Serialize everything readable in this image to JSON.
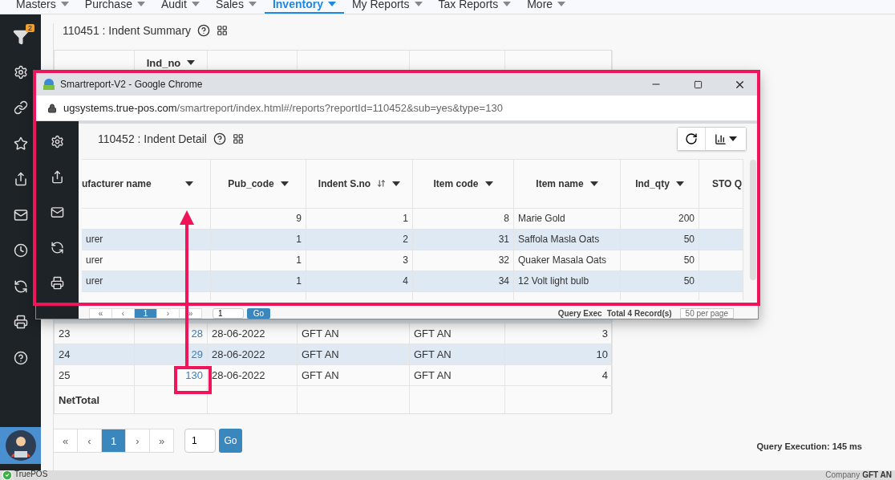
{
  "nav": [
    {
      "label": "Masters",
      "selected": false
    },
    {
      "label": "Purchase",
      "selected": false
    },
    {
      "label": "Audit",
      "selected": false
    },
    {
      "label": "Sales",
      "selected": false
    },
    {
      "label": "Inventory",
      "selected": true
    },
    {
      "label": "My Reports",
      "selected": false
    },
    {
      "label": "Tax Reports",
      "selected": false
    },
    {
      "label": "More",
      "selected": false
    }
  ],
  "sidebar": {
    "filter_badge": "2"
  },
  "report": {
    "title": "110451 : Indent Summary",
    "columns": [
      null,
      {
        "label": "Ind_no"
      },
      null,
      null,
      null,
      null
    ],
    "rows": [
      [
        "23",
        "28",
        "28-06-2022",
        "GFT AN",
        "GFT AN",
        "3"
      ],
      [
        "24",
        "29",
        "28-06-2022",
        "GFT AN",
        "GFT AN",
        "10"
      ],
      [
        "25",
        "130",
        "28-06-2022",
        "GFT AN",
        "GFT AN",
        "4"
      ]
    ],
    "total_label": "NetTotal",
    "pagination": {
      "pages": [
        {
          "label": "«",
          "selected": false
        },
        {
          "label": "‹",
          "selected": false
        },
        {
          "label": "1",
          "selected": true
        },
        {
          "label": "›",
          "selected": false
        },
        {
          "label": "»",
          "selected": false
        }
      ],
      "page_input": "1",
      "go": "Go"
    },
    "query_execution": "Query Execution: 145 ms"
  },
  "popup": {
    "window_title": "Smartreport-V2 - Google Chrome",
    "url_host": "ugsystems.true-pos.com",
    "url_path": "/smartreport/index.html#/reports?reportId=110452&sub=yes&type=130",
    "title": "110452 : Indent Detail",
    "columns": [
      {
        "label": "ufacturer name",
        "sort": false
      },
      {
        "label": "Pub_code",
        "sort": false
      },
      {
        "label": "Indent S.no",
        "sort": true
      },
      {
        "label": "Item code",
        "sort": false
      },
      {
        "label": "Item name",
        "sort": false
      },
      {
        "label": "Ind_qty",
        "sort": false
      },
      {
        "label": "STO Q",
        "sort": false
      }
    ],
    "rows": [
      [
        "",
        "9",
        "1",
        "8",
        "Marie Gold",
        "200",
        ""
      ],
      [
        "urer",
        "1",
        "2",
        "31",
        "Saffola Masla Oats",
        "50",
        ""
      ],
      [
        "urer",
        "1",
        "3",
        "32",
        "Quaker Masala Oats",
        "50",
        ""
      ],
      [
        "urer",
        "1",
        "4",
        "34",
        "12 Volt light bulb",
        "50",
        ""
      ]
    ],
    "pagination": {
      "pages": [
        {
          "label": "«",
          "selected": false
        },
        {
          "label": "‹",
          "selected": false
        },
        {
          "label": "1",
          "selected": true
        },
        {
          "label": "›",
          "selected": false
        },
        {
          "label": "»",
          "selected": false
        }
      ],
      "page_input": "1",
      "go": "Go"
    },
    "query_execution": "Query Exec",
    "total_records": "Total 4 Record(s)",
    "per_page": "50 per page"
  },
  "status_bar": {
    "app": "TruePOS",
    "company_label": "Company",
    "company": "GFT AN"
  }
}
